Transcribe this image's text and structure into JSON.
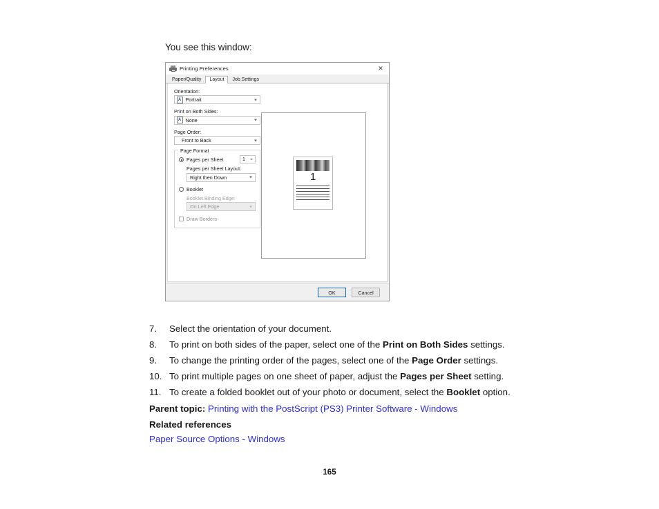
{
  "intro": "You see this window:",
  "dialog": {
    "title": "Printing Preferences",
    "close_icon": "✕",
    "tabs": [
      {
        "label": "Paper/Quality",
        "selected": false
      },
      {
        "label": "Layout",
        "selected": true
      },
      {
        "label": "Job Settings",
        "selected": false
      }
    ],
    "fields": {
      "orientation_label": "Orientation:",
      "orientation_value": "Portrait",
      "orientation_icon_glyph": "A",
      "both_sides_label": "Print on Both Sides:",
      "both_sides_value": "None",
      "both_sides_icon_glyph": "A",
      "page_order_label": "Page Order:",
      "page_order_value": "Front to Back"
    },
    "page_format": {
      "group_title": "Page Format",
      "pages_per_sheet_label": "Pages per Sheet",
      "pages_per_sheet_value": "1",
      "layout_label": "Pages per Sheet Layout:",
      "layout_value": "Right then Down",
      "booklet_label": "Booklet",
      "binding_edge_label": "Booklet Binding Edge:",
      "binding_edge_value": "On Left Edge",
      "draw_borders_label": "Draw Borders"
    },
    "preview": {
      "page_number_glyph": "1"
    },
    "buttons": {
      "ok": "OK",
      "cancel": "Cancel"
    },
    "colors": {
      "focus_border": "#1266c4",
      "orientation_icon": "#2a5db0"
    }
  },
  "steps": [
    {
      "num": "7.",
      "text": "Select the orientation of your document.",
      "bold": "",
      "after": ""
    },
    {
      "num": "8.",
      "text": "To print on both sides of the paper, select one of the ",
      "bold": "Print on Both Sides",
      "after": " settings."
    },
    {
      "num": "9.",
      "text": "To change the printing order of the pages, select one of the ",
      "bold": "Page Order",
      "after": " settings."
    },
    {
      "num": "10.",
      "text": "To print multiple pages on one sheet of paper, adjust the ",
      "bold": "Pages per Sheet",
      "after": " setting."
    },
    {
      "num": "11.",
      "text": "To create a folded booklet out of your photo or document, select the ",
      "bold": "Booklet",
      "after": " option."
    }
  ],
  "parent_topic": {
    "label": "Parent topic:",
    "link": "Printing with the PostScript (PS3) Printer Software - Windows"
  },
  "related": {
    "heading": "Related references",
    "links": [
      "Paper Source Options - Windows"
    ]
  },
  "page_number": "165",
  "link_color": "#2b2be0"
}
